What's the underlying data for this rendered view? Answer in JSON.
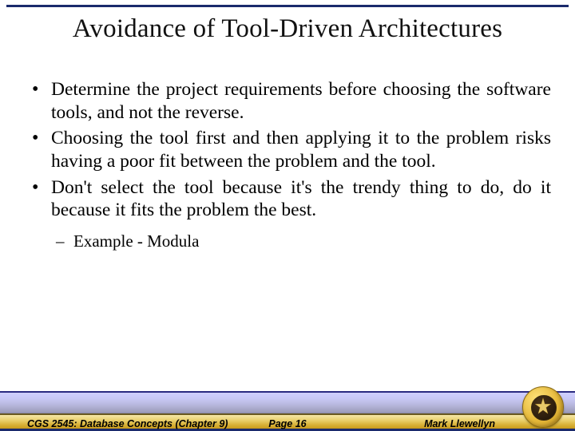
{
  "title": "Avoidance of Tool-Driven Architectures",
  "bullets": [
    "Determine the project requirements before choosing the software tools, and not the reverse.",
    "Choosing the tool first and then applying it to the problem risks having a poor fit between the problem and the tool.",
    "Don't select the tool because it's the trendy thing to do, do it because it fits the problem the best."
  ],
  "sub_bullet": "Example - Modula",
  "footer": {
    "left": "CGS 2545: Database Concepts  (Chapter 9)",
    "center": "Page 16",
    "right": "Mark Llewellyn"
  }
}
